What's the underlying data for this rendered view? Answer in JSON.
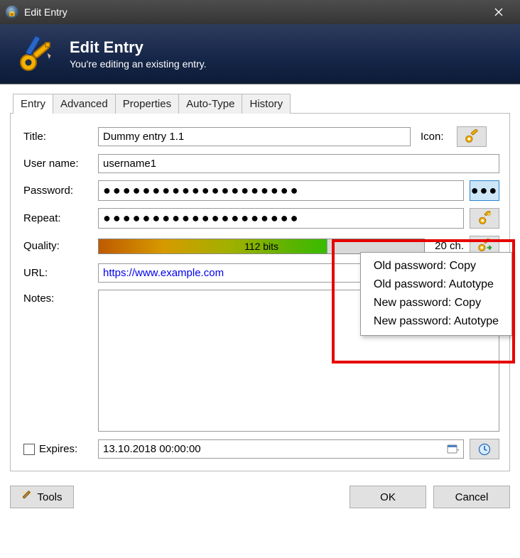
{
  "window": {
    "title": "Edit Entry"
  },
  "banner": {
    "heading": "Edit Entry",
    "sub": "You're editing an existing entry."
  },
  "tabs": [
    "Entry",
    "Advanced",
    "Properties",
    "Auto-Type",
    "History"
  ],
  "labels": {
    "title": "Title:",
    "username": "User name:",
    "password": "Password:",
    "repeat": "Repeat:",
    "quality": "Quality:",
    "url": "URL:",
    "notes": "Notes:",
    "expires": "Expires:",
    "icon": "Icon:"
  },
  "fields": {
    "title": "Dummy entry 1.1",
    "username": "username1",
    "password_mask": "●●●●●●●●●●●●●●●●●●●●",
    "repeat_mask": "●●●●●●●●●●●●●●●●●●●●",
    "quality_bits": "112 bits",
    "char_count": "20 ch.",
    "url": "https://www.example.com",
    "notes": "",
    "expires": "13.10.2018 00:00:00"
  },
  "popup": {
    "items": [
      "Old password: Copy",
      "Old password: Autotype",
      "New password: Copy",
      "New password: Autotype"
    ]
  },
  "buttons": {
    "tools": "Tools",
    "ok": "OK",
    "cancel": "Cancel"
  }
}
